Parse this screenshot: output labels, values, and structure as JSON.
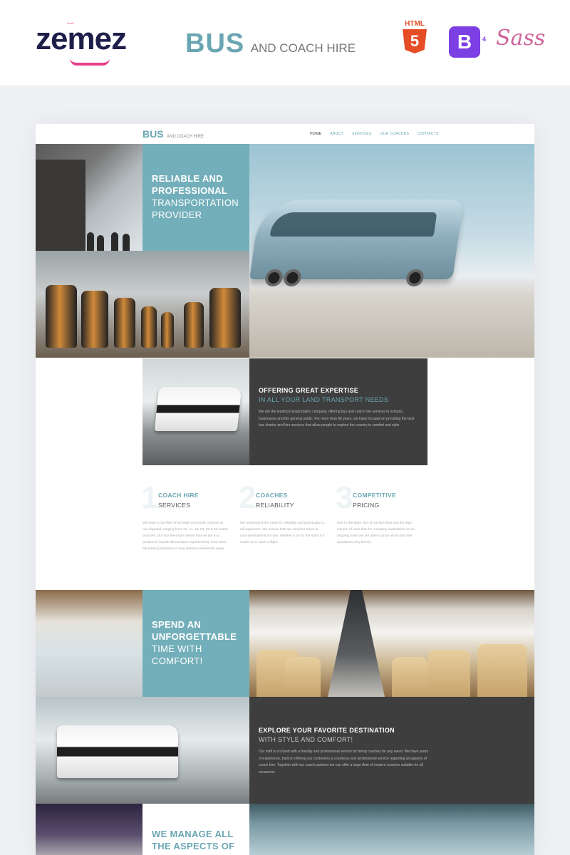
{
  "promo": {
    "zemez_logo": "zemez",
    "brand_big": "BUS",
    "brand_small": "AND COACH HIRE",
    "badges": {
      "html": "HTML",
      "html_num": "5",
      "bootstrap": "B",
      "bootstrap_ver": "4",
      "sass": "Sass"
    }
  },
  "site": {
    "logo_big": "BUS",
    "logo_small": "AND COACH HIRE",
    "nav": [
      "HOME",
      "ABOUT",
      "SERVICES",
      "OUR COACHES",
      "CONTACTS"
    ]
  },
  "hero": {
    "line1": "RELIABLE AND",
    "line2": "PROFESSIONAL",
    "line3": "TRANSPORTATION",
    "line4": "PROVIDER"
  },
  "expertise": {
    "title": "OFFERING GREAT EXPERTISE",
    "subtitle": "IN ALL YOUR LAND TRANSPORT NEEDS",
    "text": "We are the leading transportation company, offering bus and coach hire services to schools, businesses and the general public. For more than 80 years, we have focused on providing the best bus charter and hire services that allow people to explore the country in comfort and style."
  },
  "features": [
    {
      "num": "1",
      "title": "COACH HIRE",
      "subtitle": "SERVICES",
      "text": "We have a bus fleet of 50-large and small coaches at our disposal, ranging from 12, 14, 18, 24, 33 & 50 seater coaches. Our bus fleet size means that we are in a position to handle all transport requirements, from short trip training sessions to long distance weekends away."
    },
    {
      "num": "2",
      "title": "COACHES",
      "subtitle": "RELIABILITY",
      "text": "We understand the need for reliability and punctuality to all organisers. We ensure that our coaches arrive at your destinations on time, whether it be for the start of a match or to catch a flight."
    },
    {
      "num": "3",
      "title": "COMPETITIVE",
      "subtitle": "PRICING",
      "text": "Due to the large size of our bus fleet and the high volume of work that the company undertakes on an ongoing basis we are able to price all our taxi hire quotations very keenly."
    }
  ],
  "comfort": {
    "line1": "SPEND AN",
    "line2": "UNFORGETTABLE",
    "line3": "TIME WITH",
    "line4": "COMFORT!"
  },
  "explore": {
    "title": "EXPLORE YOUR FAVORITE DESTINATION",
    "subtitle": "WITH STYLE AND COMFORT!",
    "text": "Our staff is on hand with a friendly and professional service for hiring coaches for any event. We have years of experience, built on offering our customers a courteous and professional service regarding all aspects of coach hire. Together with our coach partners we can offer a large fleet of modern coaches suitable for all occasions."
  },
  "manage": {
    "line1": "WE MANAGE ALL",
    "line2": "THE ASPECTS OF"
  },
  "colors": {
    "accent": "#6aa6b2",
    "teal_tile": "#73afba",
    "dark_tile": "#3e3e3e",
    "zemez_navy": "#1d1f4a",
    "zemez_pink": "#e83e8c",
    "html_orange": "#e44d26",
    "bootstrap_purple": "#7b3fe4",
    "sass_pink": "#cf649a"
  }
}
